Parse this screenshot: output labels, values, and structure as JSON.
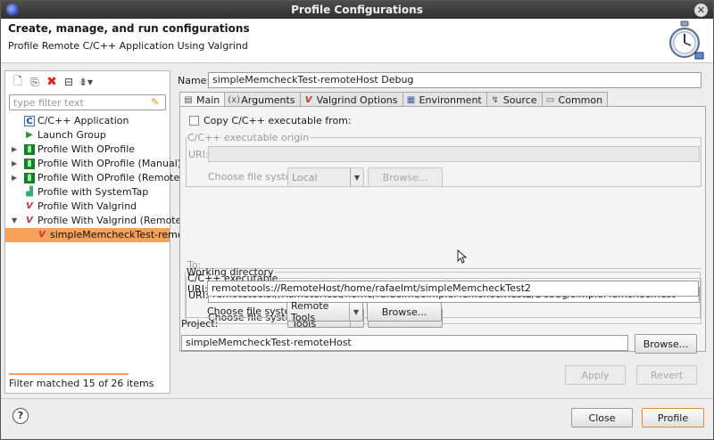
{
  "window": {
    "title": "Profile Configurations"
  },
  "header": {
    "title": "Create, manage, and run configurations",
    "subtitle": "Profile Remote C/C++ Application Using Valgrind",
    "icon": "stopwatch-icon"
  },
  "left": {
    "filter_placeholder": "type filter text",
    "tree": [
      {
        "label": "C/C++ Application",
        "icon": "c-app-icon",
        "expand": ""
      },
      {
        "label": "Launch Group",
        "icon": "launch-group-icon",
        "expand": ""
      },
      {
        "label": "Profile With OProfile",
        "icon": "oprofile-icon",
        "expand": "▶"
      },
      {
        "label": "Profile With OProfile (Manual)",
        "icon": "oprofile-icon",
        "expand": "▶"
      },
      {
        "label": "Profile With OProfile (Remote)",
        "icon": "oprofile-icon",
        "expand": "▶"
      },
      {
        "label": "Profile with SystemTap",
        "icon": "systemtap-icon",
        "expand": ""
      },
      {
        "label": "Profile With Valgrind",
        "icon": "valgrind-icon",
        "expand": ""
      },
      {
        "label": "Profile With Valgrind (Remote)",
        "icon": "valgrind-icon",
        "expand": "▼"
      },
      {
        "label": "simpleMemcheckTest-remote",
        "icon": "valgrind-icon",
        "expand": ""
      }
    ],
    "status": "Filter matched 15 of 26 items"
  },
  "right": {
    "name_label": "Name:",
    "name_value": "simpleMemcheckTest-remoteHost Debug",
    "tabs": [
      {
        "label": "Main",
        "icon": "main-tab-icon"
      },
      {
        "label": "Arguments",
        "icon": "arguments-tab-icon"
      },
      {
        "label": "Valgrind Options",
        "icon": "valgrind-tab-icon"
      },
      {
        "label": "Environment",
        "icon": "environment-tab-icon"
      },
      {
        "label": "Source",
        "icon": "source-tab-icon"
      },
      {
        "label": "Common",
        "icon": "common-tab-icon"
      }
    ],
    "main": {
      "copy_label": "Copy C/C++ executable from:",
      "origin_legend": "C/C++ executable origin",
      "uri_label": "URI:",
      "origin_uri": "",
      "choose_fs_label": "Choose file system:",
      "origin_fs": "Local",
      "browse_label": "Browse...",
      "to_label": "To:",
      "exe_legend": "C/C++ executable",
      "exe_uri": "remotetools://RemoteHost/home/rafaelmt/simpleMemcheckTest2/Debug/simpleMemcheckTest",
      "exe_fs": "Remote Tools",
      "wd_legend": "Working directory",
      "wd_uri": "remotetools://RemoteHost/home/rafaelmt/simpleMemcheckTest2",
      "wd_fs": "Remote Tools",
      "project_label": "Project:",
      "project_value": "simpleMemcheckTest-remoteHost",
      "browse_project_label": "Browse..."
    },
    "apply_label": "Apply",
    "revert_label": "Revert"
  },
  "footer": {
    "help_label": "?",
    "close_label": "Close",
    "profile_label": "Profile"
  }
}
